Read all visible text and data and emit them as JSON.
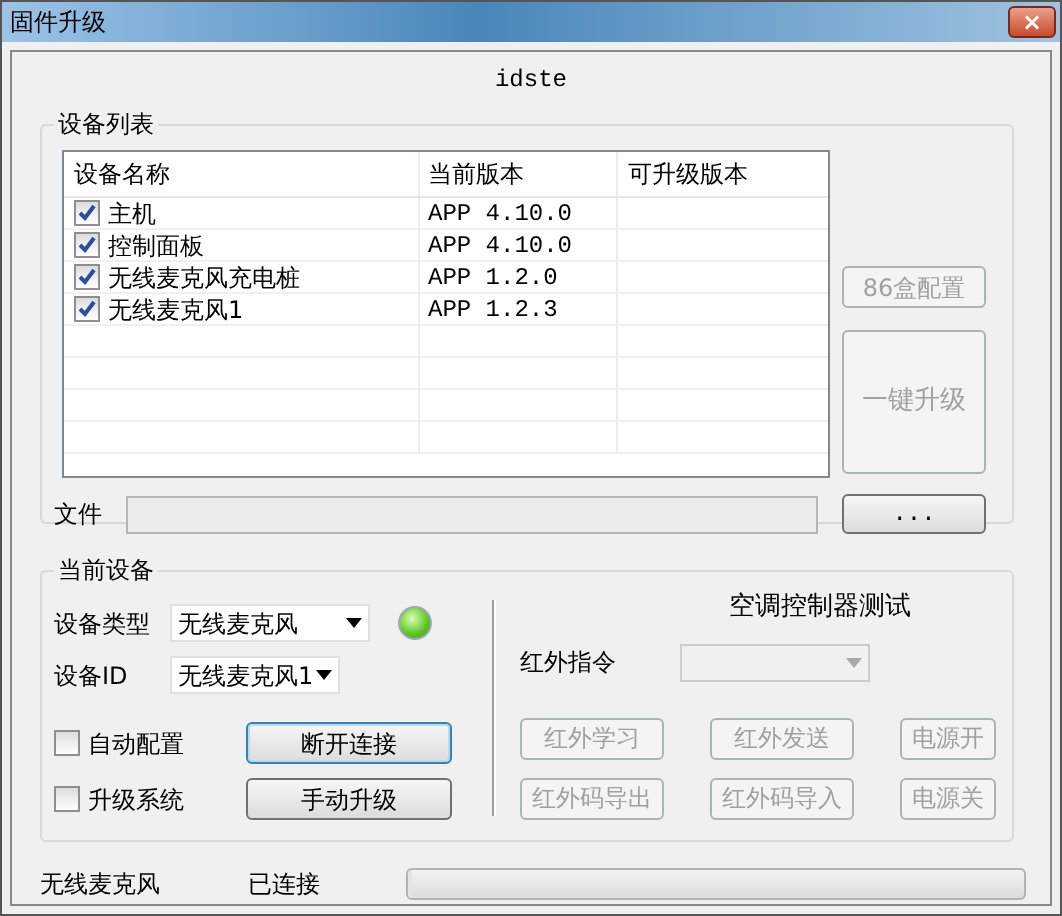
{
  "window": {
    "title": "固件升级",
    "close": "×"
  },
  "subtitle": "idste",
  "device_list": {
    "title": "设备列表",
    "columns": [
      "设备名称",
      "当前版本",
      "可升级版本"
    ],
    "rows": [
      {
        "name": "主机",
        "version": "APP 4.10.0",
        "checked": true
      },
      {
        "name": "控制面板",
        "version": "APP 4.10.0",
        "checked": true
      },
      {
        "name": "无线麦克风充电桩",
        "version": "APP 1.2.0",
        "checked": true
      },
      {
        "name": "无线麦克风1",
        "version": "APP 1.2.3",
        "checked": true
      }
    ],
    "buttons": [
      {
        "label": "86盒配置",
        "disabled": true
      },
      {
        "label": "一键升级",
        "disabled": true
      }
    ],
    "file_label": "文件",
    "browse_button": {
      "label": "...",
      "disabled": false
    }
  },
  "current_device": {
    "title": "当前设备",
    "type_label": "设备类型",
    "type_value": "无线麦克风",
    "id_label": "设备ID",
    "id_value": "无线麦克风1",
    "options": [
      {
        "label": "自动配置",
        "checked": false
      },
      {
        "label": "升级系统",
        "checked": false
      }
    ],
    "buttons": [
      {
        "label": "断开连接",
        "focused": true
      },
      {
        "label": "手动升级",
        "focused": false
      }
    ],
    "ac_test": {
      "title": "空调控制器测试",
      "ir_label": "红外指令",
      "ir_disabled": true,
      "buttons": [
        {
          "label": "红外学习",
          "disabled": true
        },
        {
          "label": "红外发送",
          "disabled": true
        },
        {
          "label": "电源开",
          "disabled": true
        },
        {
          "label": "红外码导出",
          "disabled": true
        },
        {
          "label": "红外码导入",
          "disabled": true
        },
        {
          "label": "电源关",
          "disabled": true
        }
      ]
    }
  },
  "status_bar": {
    "device": "无线麦克风",
    "state": "已连接",
    "level": 0
  }
}
